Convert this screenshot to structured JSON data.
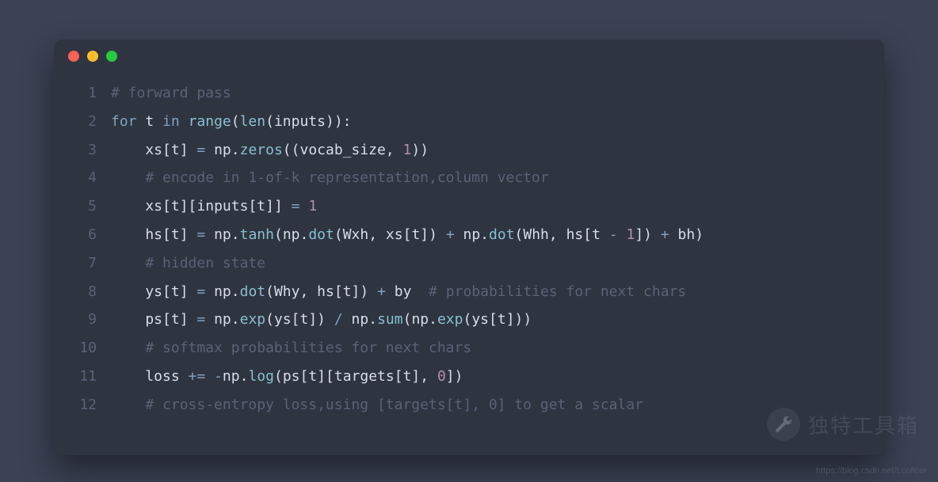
{
  "window": {
    "dots": [
      "red",
      "yellow",
      "green"
    ]
  },
  "code": {
    "lines": [
      {
        "n": "1",
        "tokens": [
          [
            "cm",
            "# forward pass"
          ]
        ]
      },
      {
        "n": "2",
        "tokens": [
          [
            "kw",
            "for"
          ],
          [
            "id",
            " t "
          ],
          [
            "kw",
            "in"
          ],
          [
            "id",
            " "
          ],
          [
            "fn",
            "range"
          ],
          [
            "pn",
            "("
          ],
          [
            "fn",
            "len"
          ],
          [
            "pn",
            "("
          ],
          [
            "id",
            "inputs"
          ],
          [
            "pn",
            "))"
          ],
          [
            "pn",
            ":"
          ]
        ]
      },
      {
        "n": "3",
        "tokens": [
          [
            "id",
            "    xs"
          ],
          [
            "pn",
            "["
          ],
          [
            "id",
            "t"
          ],
          [
            "pn",
            "]"
          ],
          [
            "id",
            " "
          ],
          [
            "op",
            "="
          ],
          [
            "id",
            " np"
          ],
          [
            "pn",
            "."
          ],
          [
            "fn",
            "zeros"
          ],
          [
            "pn",
            "(("
          ],
          [
            "id",
            "vocab_size"
          ],
          [
            "pn",
            ", "
          ],
          [
            "num",
            "1"
          ],
          [
            "pn",
            "))"
          ]
        ]
      },
      {
        "n": "4",
        "tokens": [
          [
            "id",
            "    "
          ],
          [
            "cm",
            "# encode in 1-of-k representation,column vector"
          ]
        ]
      },
      {
        "n": "5",
        "tokens": [
          [
            "id",
            "    xs"
          ],
          [
            "pn",
            "["
          ],
          [
            "id",
            "t"
          ],
          [
            "pn",
            "]["
          ],
          [
            "id",
            "inputs"
          ],
          [
            "pn",
            "["
          ],
          [
            "id",
            "t"
          ],
          [
            "pn",
            "]]"
          ],
          [
            "id",
            " "
          ],
          [
            "op",
            "="
          ],
          [
            "id",
            " "
          ],
          [
            "num",
            "1"
          ]
        ]
      },
      {
        "n": "6",
        "tokens": [
          [
            "id",
            "    hs"
          ],
          [
            "pn",
            "["
          ],
          [
            "id",
            "t"
          ],
          [
            "pn",
            "]"
          ],
          [
            "id",
            " "
          ],
          [
            "op",
            "="
          ],
          [
            "id",
            " np"
          ],
          [
            "pn",
            "."
          ],
          [
            "fn",
            "tanh"
          ],
          [
            "pn",
            "("
          ],
          [
            "id",
            "np"
          ],
          [
            "pn",
            "."
          ],
          [
            "fn",
            "dot"
          ],
          [
            "pn",
            "("
          ],
          [
            "id",
            "Wxh"
          ],
          [
            "pn",
            ", "
          ],
          [
            "id",
            "xs"
          ],
          [
            "pn",
            "["
          ],
          [
            "id",
            "t"
          ],
          [
            "pn",
            "])"
          ],
          [
            "id",
            " "
          ],
          [
            "op",
            "+"
          ],
          [
            "id",
            " np"
          ],
          [
            "pn",
            "."
          ],
          [
            "fn",
            "dot"
          ],
          [
            "pn",
            "("
          ],
          [
            "id",
            "Whh"
          ],
          [
            "pn",
            ", "
          ],
          [
            "id",
            "hs"
          ],
          [
            "pn",
            "["
          ],
          [
            "id",
            "t "
          ],
          [
            "op",
            "-"
          ],
          [
            "id",
            " "
          ],
          [
            "num",
            "1"
          ],
          [
            "pn",
            "])"
          ],
          [
            "id",
            " "
          ],
          [
            "op",
            "+"
          ],
          [
            "id",
            " bh"
          ],
          [
            "pn",
            ")"
          ]
        ]
      },
      {
        "n": "7",
        "tokens": [
          [
            "id",
            "    "
          ],
          [
            "cm",
            "# hidden state"
          ]
        ]
      },
      {
        "n": "8",
        "tokens": [
          [
            "id",
            "    ys"
          ],
          [
            "pn",
            "["
          ],
          [
            "id",
            "t"
          ],
          [
            "pn",
            "]"
          ],
          [
            "id",
            " "
          ],
          [
            "op",
            "="
          ],
          [
            "id",
            " np"
          ],
          [
            "pn",
            "."
          ],
          [
            "fn",
            "dot"
          ],
          [
            "pn",
            "("
          ],
          [
            "id",
            "Why"
          ],
          [
            "pn",
            ", "
          ],
          [
            "id",
            "hs"
          ],
          [
            "pn",
            "["
          ],
          [
            "id",
            "t"
          ],
          [
            "pn",
            "])"
          ],
          [
            "id",
            " "
          ],
          [
            "op",
            "+"
          ],
          [
            "id",
            " by  "
          ],
          [
            "cm",
            "# probabilities for next chars"
          ]
        ]
      },
      {
        "n": "9",
        "tokens": [
          [
            "id",
            "    ps"
          ],
          [
            "pn",
            "["
          ],
          [
            "id",
            "t"
          ],
          [
            "pn",
            "]"
          ],
          [
            "id",
            " "
          ],
          [
            "op",
            "="
          ],
          [
            "id",
            " np"
          ],
          [
            "pn",
            "."
          ],
          [
            "fn",
            "exp"
          ],
          [
            "pn",
            "("
          ],
          [
            "id",
            "ys"
          ],
          [
            "pn",
            "["
          ],
          [
            "id",
            "t"
          ],
          [
            "pn",
            "])"
          ],
          [
            "id",
            " "
          ],
          [
            "op",
            "/"
          ],
          [
            "id",
            " np"
          ],
          [
            "pn",
            "."
          ],
          [
            "fn",
            "sum"
          ],
          [
            "pn",
            "("
          ],
          [
            "id",
            "np"
          ],
          [
            "pn",
            "."
          ],
          [
            "fn",
            "exp"
          ],
          [
            "pn",
            "("
          ],
          [
            "id",
            "ys"
          ],
          [
            "pn",
            "["
          ],
          [
            "id",
            "t"
          ],
          [
            "pn",
            "]))"
          ]
        ]
      },
      {
        "n": "10",
        "tokens": [
          [
            "id",
            "    "
          ],
          [
            "cm",
            "# softmax probabilities for next chars"
          ]
        ]
      },
      {
        "n": "11",
        "tokens": [
          [
            "id",
            "    loss "
          ],
          [
            "op",
            "+="
          ],
          [
            "id",
            " "
          ],
          [
            "op",
            "-"
          ],
          [
            "id",
            "np"
          ],
          [
            "pn",
            "."
          ],
          [
            "fn",
            "log"
          ],
          [
            "pn",
            "("
          ],
          [
            "id",
            "ps"
          ],
          [
            "pn",
            "["
          ],
          [
            "id",
            "t"
          ],
          [
            "pn",
            "]["
          ],
          [
            "id",
            "targets"
          ],
          [
            "pn",
            "["
          ],
          [
            "id",
            "t"
          ],
          [
            "pn",
            "], "
          ],
          [
            "num",
            "0"
          ],
          [
            "pn",
            "])"
          ]
        ]
      },
      {
        "n": "12",
        "tokens": [
          [
            "id",
            "    "
          ],
          [
            "cm",
            "# cross-entropy loss,using [targets[t], 0] to get a scalar"
          ]
        ]
      }
    ]
  },
  "watermark": {
    "text": "独特工具箱",
    "url": "https://blog.csdn.net/Lcoficer"
  }
}
